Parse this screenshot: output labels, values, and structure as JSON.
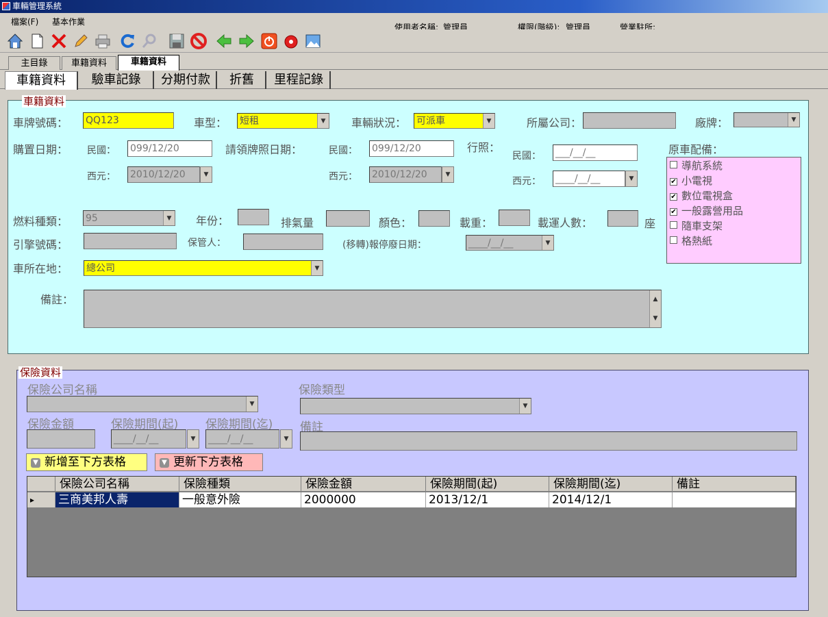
{
  "window": {
    "title": "車輛管理系統"
  },
  "menu": {
    "file": "檔案(F)",
    "basic": "基本作業"
  },
  "status": {
    "user_label": "使用者名稱:",
    "user_value": "管理員",
    "role_label": "權限(階級):",
    "role_value": "管理員",
    "site_label": "營業駐所:"
  },
  "toolbar_icons": [
    "home-icon",
    "new-document-icon",
    "delete-icon",
    "edit-pencil-icon",
    "print-icon",
    "refresh-icon",
    "search-icon",
    "save-icon",
    "cancel-icon",
    "back-arrow-icon",
    "forward-arrow-icon",
    "power-icon",
    "alarm-icon",
    "image-icon"
  ],
  "top_tabs": [
    "主目錄",
    "車籍資料",
    "車籍資料"
  ],
  "sub_tabs": [
    "車籍資料",
    "驗車記錄",
    "分期付款",
    "折舊",
    "里程記錄"
  ],
  "vehicle": {
    "legend": "車籍資料",
    "plate_label": "車牌號碼：",
    "plate_value": "QQ123",
    "type_label": "車型：",
    "type_value": "短租",
    "status_label": "車輛狀況：",
    "status_value": "可派車",
    "company_label": "所屬公司：",
    "brand_label": "廠牌：",
    "purchase_label": "購置日期：",
    "roc_label": "民國：",
    "ad_label": "西元：",
    "purchase_roc": "099/12/20",
    "purchase_ad": "2010/12/20",
    "license_label": "請領牌照日期：",
    "license_roc": "099/12/20",
    "license_ad": "2010/12/20",
    "permit_label": "行照：",
    "permit_roc_label": "民國：",
    "permit_ad_label": "西元：",
    "permit_roc": "___/__/__",
    "permit_ad": "____/__/__",
    "fuel_label": "燃料種類：",
    "fuel_value": "95",
    "year_label": "年份：",
    "displacement_label": "排氣量",
    "color_label": "顏色：",
    "load_label": "載重：",
    "capacity_label": "載運人數：",
    "seat_unit": "座",
    "engine_label": "引擎號碼：",
    "custodian_label": "保管人：",
    "scrap_label": "(移轉)報停廢日期：",
    "scrap_value": "____/__/__",
    "location_label": "車所在地：",
    "location_value": "總公司",
    "note_label": "備註：",
    "equip_label": "原車配備：",
    "equipment": [
      {
        "label": "導航系統",
        "checked": false,
        "mark": ""
      },
      {
        "label": "小電視",
        "checked": true,
        "mark": "✔"
      },
      {
        "label": "數位電視盒",
        "checked": true,
        "mark": "✔"
      },
      {
        "label": "一般露營用品",
        "checked": true,
        "mark": "✔"
      },
      {
        "label": "隨車支架",
        "checked": false,
        "mark": ""
      },
      {
        "label": "格熱紙",
        "checked": false,
        "mark": ""
      }
    ]
  },
  "insurance": {
    "legend": "保險資料",
    "company_label": "保險公司名稱",
    "type_label": "保險類型",
    "amount_label": "保險金額",
    "start_label": "保險期間(起)",
    "start_value": "____/__/__",
    "end_label": "保險期間(迄)",
    "end_value": "____/__/__",
    "note_label": "備註",
    "add_button": "新增至下方表格",
    "update_button": "更新下方表格",
    "columns": [
      "保險公司名稱",
      "保險種類",
      "保險金額",
      "保險期間(起)",
      "保險期間(迄)",
      "備註"
    ],
    "rows": [
      [
        "三商美邦人壽",
        "一般意外險",
        "2000000",
        "2013/12/1",
        "2014/12/1",
        ""
      ]
    ],
    "row_pointer": "▸"
  }
}
